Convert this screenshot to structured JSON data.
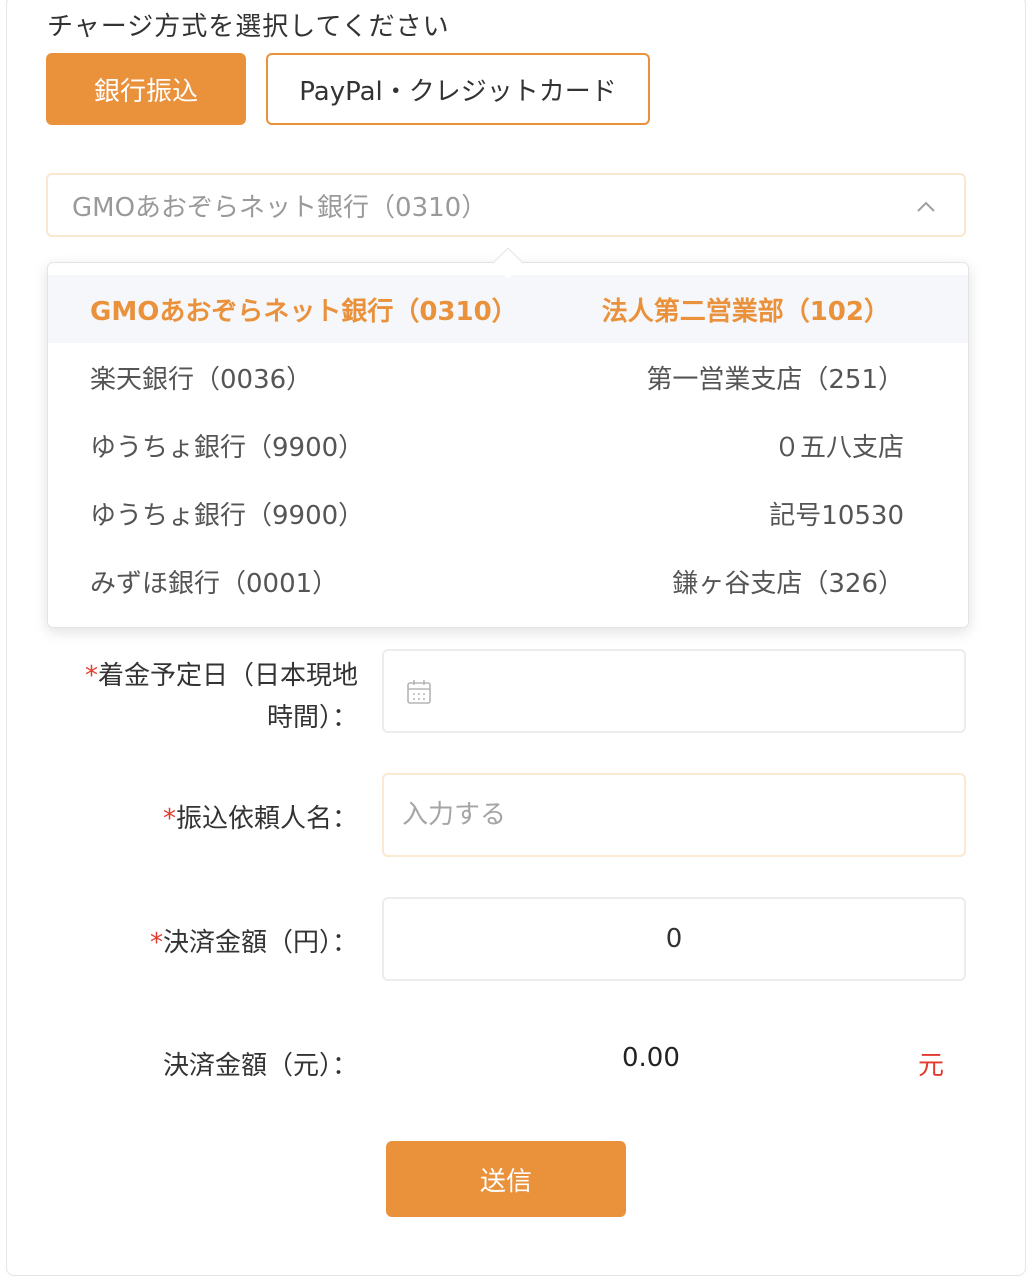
{
  "form": {
    "title": "チャージ方式を選択してください",
    "methods": [
      {
        "label": "銀行振込",
        "active": true
      },
      {
        "label": "PayPal・クレジットカード",
        "active": false
      }
    ],
    "bank_select": {
      "value": "GMOあおぞらネット銀行（0310）",
      "icon": "chevron-up-icon"
    },
    "bank_options": [
      {
        "bank": "GMOあおぞらネット銀行（0310）",
        "branch": "法人第二営業部（102）",
        "selected": true
      },
      {
        "bank": "楽天銀行（0036）",
        "branch": "第一営業支店（251）",
        "selected": false
      },
      {
        "bank": "ゆうちょ銀行（9900）",
        "branch": "０五八支店",
        "selected": false
      },
      {
        "bank": "ゆうちょ銀行（9900）",
        "branch": "記号10530",
        "selected": false
      },
      {
        "bank": "みずほ銀行（0001）",
        "branch": "鎌ヶ谷支店（326）",
        "selected": false
      }
    ],
    "arrival_date": {
      "required_mark": "*",
      "label_line1": "着金予定日（日本現地",
      "label_line2": "時間）：",
      "value": "",
      "icon": "calendar-icon"
    },
    "sender_name": {
      "required_mark": "*",
      "label": "振込依頼人名：",
      "placeholder": "入力する",
      "value": ""
    },
    "amount_jpy": {
      "required_mark": "*",
      "label": "決済金額（円）：",
      "value": "0"
    },
    "amount_cny": {
      "label": "決済金額（元）：",
      "value": "0.00",
      "unit": "元"
    },
    "submit_label": "送信"
  },
  "colors": {
    "accent": "#ea913b",
    "required": "#e23b2e",
    "selected_row_bg": "#f5f7fa"
  }
}
